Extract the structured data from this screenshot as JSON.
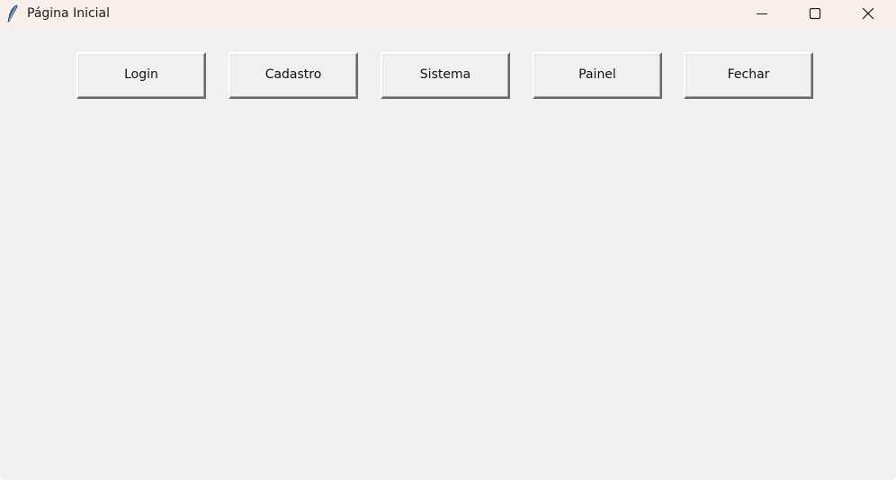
{
  "window": {
    "title": "Página Inicial",
    "icon": "feather-icon",
    "controls": {
      "minimize": "minimize-icon",
      "maximize": "maximize-icon",
      "close": "close-icon"
    }
  },
  "toolbar": {
    "buttons": [
      {
        "label": "Login"
      },
      {
        "label": "Cadastro"
      },
      {
        "label": "Sistema"
      },
      {
        "label": "Painel"
      },
      {
        "label": "Fechar"
      }
    ]
  },
  "colors": {
    "titlebar": "#f8efea",
    "window_bg": "#f0f0f0"
  }
}
